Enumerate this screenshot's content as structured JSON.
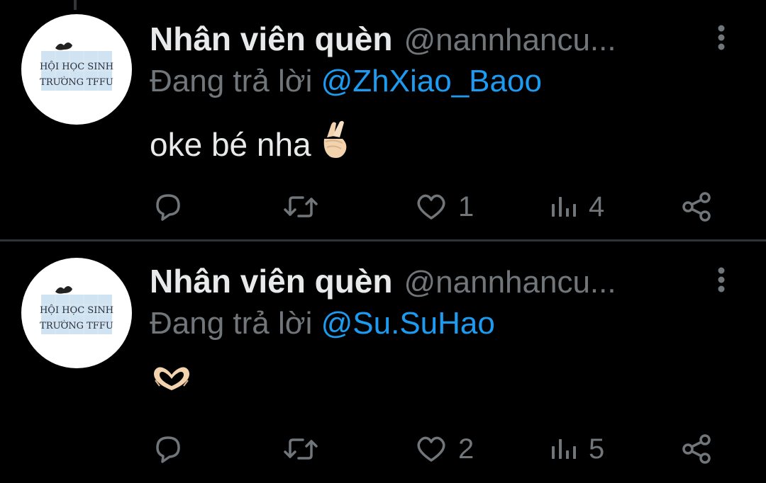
{
  "colors": {
    "background": "#000000",
    "primary_text": "#e7e9ea",
    "secondary_text": "#71767b",
    "accent": "#1d9bf0",
    "divider": "#2f3336"
  },
  "tweets": [
    {
      "display_name": "Nhân viên quèn",
      "handle": "@nannhancu...",
      "reply_prefix": "Đang trả lời",
      "reply_to": "@ZhXiao_Baoo",
      "text": "oke bé nha",
      "emoji": "crossed-fingers-emoji",
      "avatar_text": [
        "HỘI HỌC SINH",
        "TRƯỜNG TFFU"
      ],
      "icons": {
        "reply": "reply-icon",
        "retweet": "retweet-icon",
        "like": "heart-icon",
        "views": "views-icon",
        "share": "share-icon",
        "more": "more-vertical-icon"
      },
      "likes": "1",
      "views": "4"
    },
    {
      "display_name": "Nhân viên quèn",
      "handle": "@nannhancu...",
      "reply_prefix": "Đang trả lời",
      "reply_to": "@Su.SuHao",
      "text": "",
      "emoji": "heart-hands-emoji",
      "avatar_text": [
        "HỘI HỌC SINH",
        "TRƯỜNG TFFU"
      ],
      "icons": {
        "reply": "reply-icon",
        "retweet": "retweet-icon",
        "like": "heart-icon",
        "views": "views-icon",
        "share": "share-icon",
        "more": "more-vertical-icon"
      },
      "likes": "2",
      "views": "5"
    }
  ]
}
